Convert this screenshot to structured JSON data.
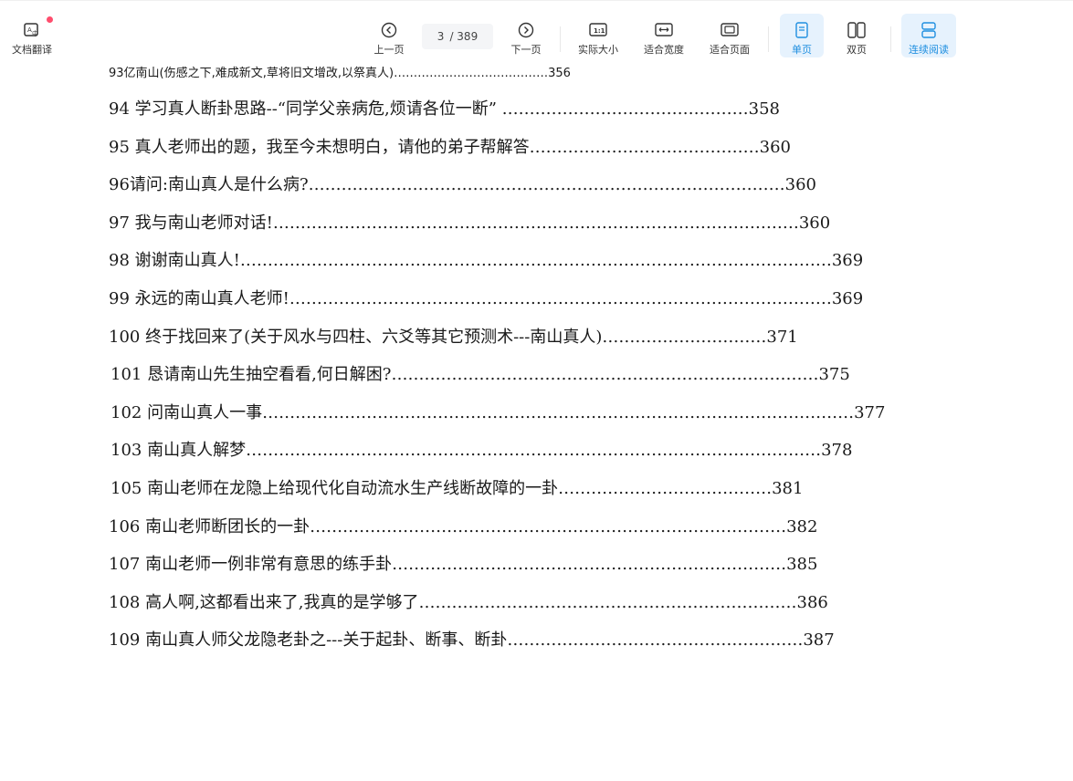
{
  "toolbar": {
    "translate_label": "文档翻译",
    "prev_label": "上一页",
    "page_current": "3",
    "page_total": "/ 389",
    "next_label": "下一页",
    "actual_size_label": "实际大小",
    "fit_width_label": "适合宽度",
    "fit_page_label": "适合页面",
    "single_page_label": "单页",
    "double_page_label": "双页",
    "continuous_label": "连续阅读",
    "accent_color": "#1f8fe0",
    "notification_color": "#ff4d6d"
  },
  "toc": [
    "93亿南山(伤感之下,难成新文,草将旧文增改,以祭真人)…………………………………356",
    "94 学习真人断卦思路--“同学父亲病危,烦请各位一断” ………………………………………358",
    "95 真人老师出的题，我至今未想明白，请他的弟子帮解答……………………………………360",
    "96请问:南山真人是什么病?……………………………………………………………………………360",
    "97 我与南山老师对话!……………………………………………………………………………………360",
    "98 谢谢南山真人!………………………………………………………………………………………………369",
    "99 永远的南山真人老师!………………………………………………………………………………………369",
    "100 终于找回来了(关于风水与四柱、六爻等其它预测术---南山真人)…………………………371",
    "101 恳请南山先生抽空看看,何日解困?……………………………………………………………………375",
    "102 问南山真人一事………………………………………………………………………………………………377",
    "103 南山真人解梦……………………………………………………………………………………………378",
    "105 南山老师在龙隐上给现代化自动流水生产线断故障的一卦…………………………………381",
    "106 南山老师断团长的一卦……………………………………………………………………………382",
    "107 南山老师一例非常有意思的练手卦………………………………………………………………385",
    "108 高人啊,这都看出来了,我真的是学够了……………………………………………………………386",
    "109 南山真人师父龙隐老卦之---关于起卦、断事、断卦………………………………………………387"
  ]
}
